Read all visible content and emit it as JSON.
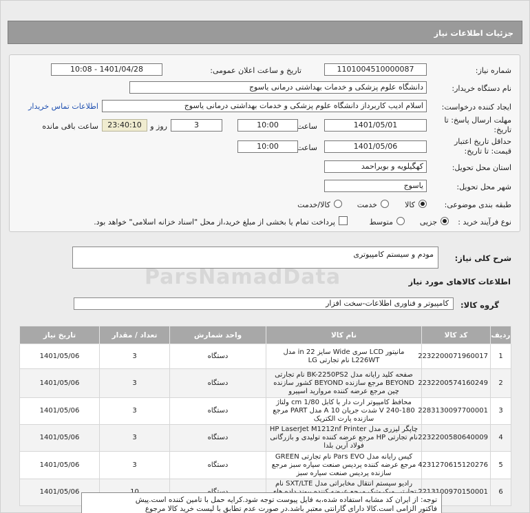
{
  "header": {
    "title": "جزئیات اطلاعات نیاز"
  },
  "form": {
    "need_number_label": "شماره نیاز:",
    "need_number": "1101004510000087",
    "announce_label": "تاریخ و ساعت اعلان عمومی:",
    "announce_value": "1401/04/28 - 10:08",
    "buyer_label": "نام دستگاه خریدار:",
    "buyer_value": "دانشگاه علوم پزشکی و خدمات بهداشتی  درمانی یاسوج",
    "creator_label": "ایجاد کننده درخواست:",
    "creator_value": "اسلام  ادیب کاربرداز دانشگاه علوم پزشکی و خدمات بهداشتی  درمانی یاسوج",
    "contact_link": "اطلاعات تماس خریدار",
    "reply_deadline_label": "مهلت ارسال پاسخ: تا",
    "reply_deadline_label2": "تاریخ:",
    "reply_date": "1401/05/01",
    "time_label": "ساعت",
    "reply_time": "10:00",
    "days_value": "3",
    "days_label": "روز و",
    "remaining_time": "23:40:10",
    "remaining_label": "ساعت باقی مانده",
    "validity_label": "حداقل تاریخ اعتبار",
    "validity_label2": "قیمت: تا تاریخ:",
    "validity_date": "1401/05/06",
    "validity_time": "10:00",
    "province_label": "استان محل تحویل:",
    "province_value": "کهگیلویه و بویراحمد",
    "city_label": "شهر محل تحویل:",
    "city_value": "یاسوج",
    "category_label": "طبقه بندی موضوعی:",
    "category_options": [
      "کالا",
      "خدمت",
      "کالا/خدمت"
    ],
    "process_label": "نوع فرآیند خرید :",
    "process_options": [
      "جزیی",
      "متوسط"
    ],
    "payment_note": "پرداخت تمام یا بخشی از مبلغ خرید،از محل \"اسناد خزانه اسلامی\" خواهد بود."
  },
  "summary": {
    "label": "شرح کلی نیاز:",
    "value": "مودم و سیستم کامپیوتری"
  },
  "goods_section": {
    "title": "اطلاعات کالاهای مورد نیاز"
  },
  "group": {
    "label": "گروه کالا:",
    "value": "کامپیوتر و فناوری اطلاعات-سخت افزار"
  },
  "table": {
    "headers": [
      "ردیف",
      "کد کالا",
      "نام کالا",
      "واحد شمارش",
      "تعداد / مقدار",
      "تاریخ نیاز"
    ],
    "rows": [
      [
        "1",
        "2232200071960017",
        "مانیتور LCD سری Wide سایز 22 in مدل L226WT نام تجارتی LG",
        "دستگاه",
        "3",
        "1401/05/06"
      ],
      [
        "2",
        "2232200574160249",
        "صفحه کلید رایانه مدل BK-2250PS2 نام تجارتی BEYOND مرجع سازنده BEYOND کشور سازنده چین مرجع عرضه کننده مروارید اسپیرو",
        "دستگاه",
        "3",
        "1401/05/06"
      ],
      [
        "3",
        "2283130097700001",
        "محافظ کامپیوتر ارت دار با کابل cm 1/80 ولتاژ 180-240 V شدت جریان 10 A مدل PART مرجع سازنده پارت الکتریک",
        "دستگاه",
        "3",
        "1401/05/06"
      ],
      [
        "4",
        "2232200580640009",
        "چاپگر لیزری مدل HP LaserJet M1212nf Printer نام تجارتی HP مرجع عرضه کننده تولیدی و بازرگانی فولاد آرین بلدا",
        "دستگاه",
        "3",
        "1401/05/06"
      ],
      [
        "5",
        "4231270615120276",
        "کیس رایانه مدل Pars EVO نام تجارتی GREEN مرجع عرضه کننده پردیس صنعت سیاره سبز مرجع سازنده پردیس صنعت سیاره سبز",
        "دستگاه",
        "3",
        "1401/05/06"
      ],
      [
        "6",
        "2213100970150001",
        "رادیو سیستم انتقال مخابراتی مدل SXT/LTE نام تجارتی میکروتیک مرجع عرضه کننده پیوند داده های صفر و یک",
        "دستگاه",
        "10",
        "1401/05/06"
      ]
    ]
  },
  "note": {
    "line1": "توجه: از ایران کد مشابه استفاده شده،به فایل پیوست توجه شود.کرایه حمل با تامین کننده است.پیش",
    "line2": "فاکتور الزامی است.کالا دارای گارانتی معتبر باشد.در صورت عدم تطابق با لیست خرید کالا مرجوع"
  },
  "watermark": "ParsNamadData"
}
